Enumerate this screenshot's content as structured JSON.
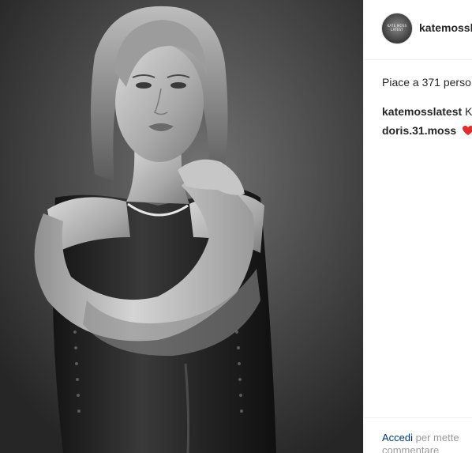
{
  "post": {
    "username": "katemossl",
    "avatar_text": "KATE MOSS LATEST",
    "likes_text": "Piace a 371 perso",
    "caption": {
      "user": "katemosslatest",
      "text": "K"
    },
    "comments": [
      {
        "user": "doris.31.moss",
        "emoji": "heart",
        "color": "#e0302d"
      }
    ],
    "footer": {
      "login_label": "Accedi",
      "login_rest_line1": "per mette",
      "login_rest_line2": "commentare"
    }
  },
  "colors": {
    "text": "#262626",
    "link": "#003569",
    "muted": "#999999",
    "divider": "#efefef"
  }
}
